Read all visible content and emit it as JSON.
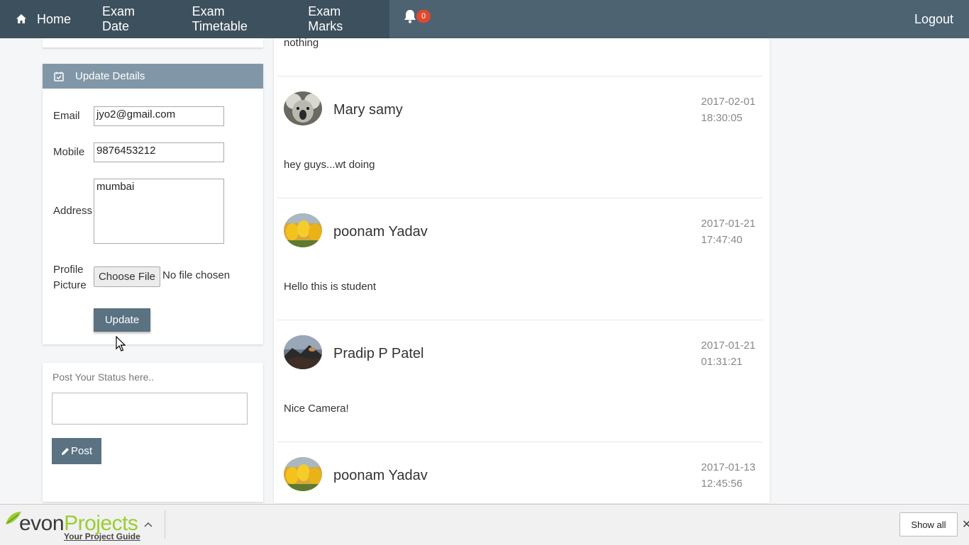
{
  "nav": {
    "home": "Home",
    "exam_date": "Exam Date",
    "exam_timetable": "Exam Timetable",
    "exam_marks": "Exam Marks",
    "notification_count": "0",
    "logout": "Logout"
  },
  "update_panel": {
    "title": "Update Details",
    "email_label": "Email",
    "email_value": "jyo2@gmail.com",
    "mobile_label": "Mobile",
    "mobile_value": "9876453212",
    "address_label": "Address",
    "address_value": "mumbai",
    "profile_label_1": "Profile",
    "profile_label_2": "Picture",
    "choose_file": "Choose File",
    "no_file": "No file chosen",
    "update_button": "Update"
  },
  "status_panel": {
    "label": "Post Your Status here..",
    "post_button": "Post"
  },
  "feed": {
    "first_message": "nothing",
    "posts": [
      {
        "author": "Mary samy",
        "date": "2017-02-01",
        "time": "18:30:05",
        "message": "hey guys...wt doing",
        "avatar": "koala"
      },
      {
        "author": "poonam Yadav",
        "date": "2017-01-21",
        "time": "17:47:40",
        "message": "Hello this is student",
        "avatar": "tulips"
      },
      {
        "author": "Pradip P Patel",
        "date": "2017-01-21",
        "time": "01:31:21",
        "message": "Nice Camera!",
        "avatar": "landscape"
      },
      {
        "author": "poonam Yadav",
        "date": "2017-01-13",
        "time": "12:45:56",
        "message": "",
        "avatar": "tulips"
      }
    ]
  },
  "bottom": {
    "logo_part1": "evon",
    "logo_part2": "Projects",
    "tagline": "Your Project Guide",
    "show_all": "Show all"
  },
  "colors": {
    "nav_bg": "#4d6372",
    "nav_active_bg": "#3d505e",
    "panel_header": "#8197a8",
    "button": "#5a7282",
    "badge": "#e0492f"
  }
}
